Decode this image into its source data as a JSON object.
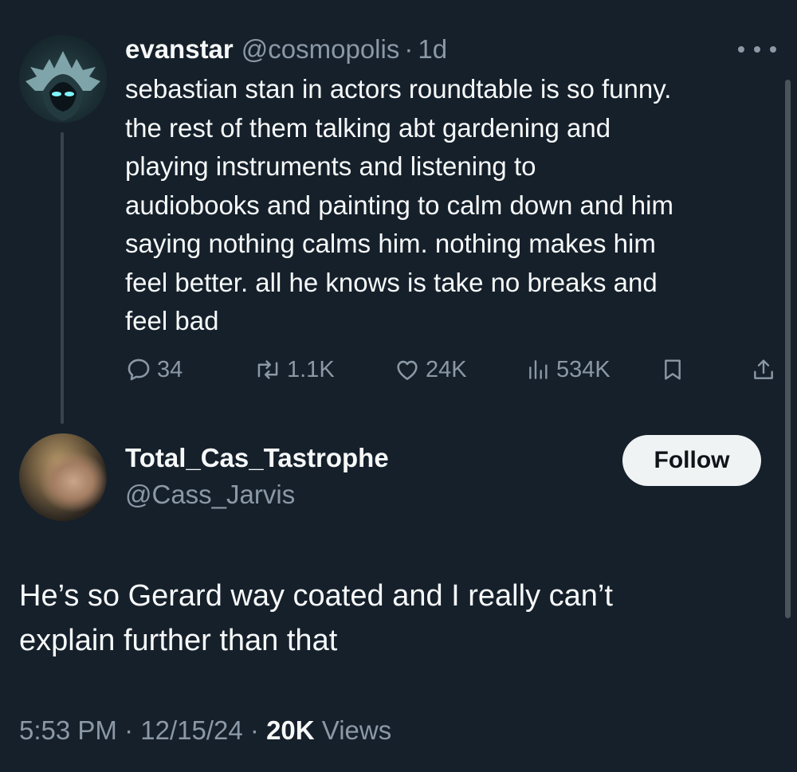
{
  "parent_tweet": {
    "display_name": "evanstar",
    "handle": "@cosmopolis",
    "separator": "·",
    "time_ago": "1d",
    "text": "sebastian stan in actors roundtable is so funny.\nthe rest of them talking abt gardening and\nplaying instruments and listening to\naudiobooks and painting to calm down and him\nsaying nothing calms him. nothing makes him\nfeel better. all he knows is take no breaks and\nfeel bad",
    "actions": {
      "reply_count": "34",
      "repost_count": "1.1K",
      "like_count": "24K",
      "view_count": "534K"
    },
    "icons": [
      "reply-icon",
      "repost-icon",
      "like-icon",
      "views-icon",
      "bookmark-icon",
      "share-icon"
    ]
  },
  "reply_tweet": {
    "display_name": "Total_Cas_Tastrophe",
    "handle": "@Cass_Jarvis",
    "follow_label": "Follow",
    "text": "He’s so Gerard way coated and I really can’t\nexplain further than that",
    "time": "5:53 PM",
    "date": "12/15/24",
    "separator": "·",
    "views_count": "20K",
    "views_label": "Views"
  },
  "colors": {
    "background": "#15202b",
    "primary_text": "#f7f9f9",
    "secondary_text": "#8b98a5",
    "follow_button_bg": "#eff3f4",
    "thread_line": "#38444d"
  }
}
